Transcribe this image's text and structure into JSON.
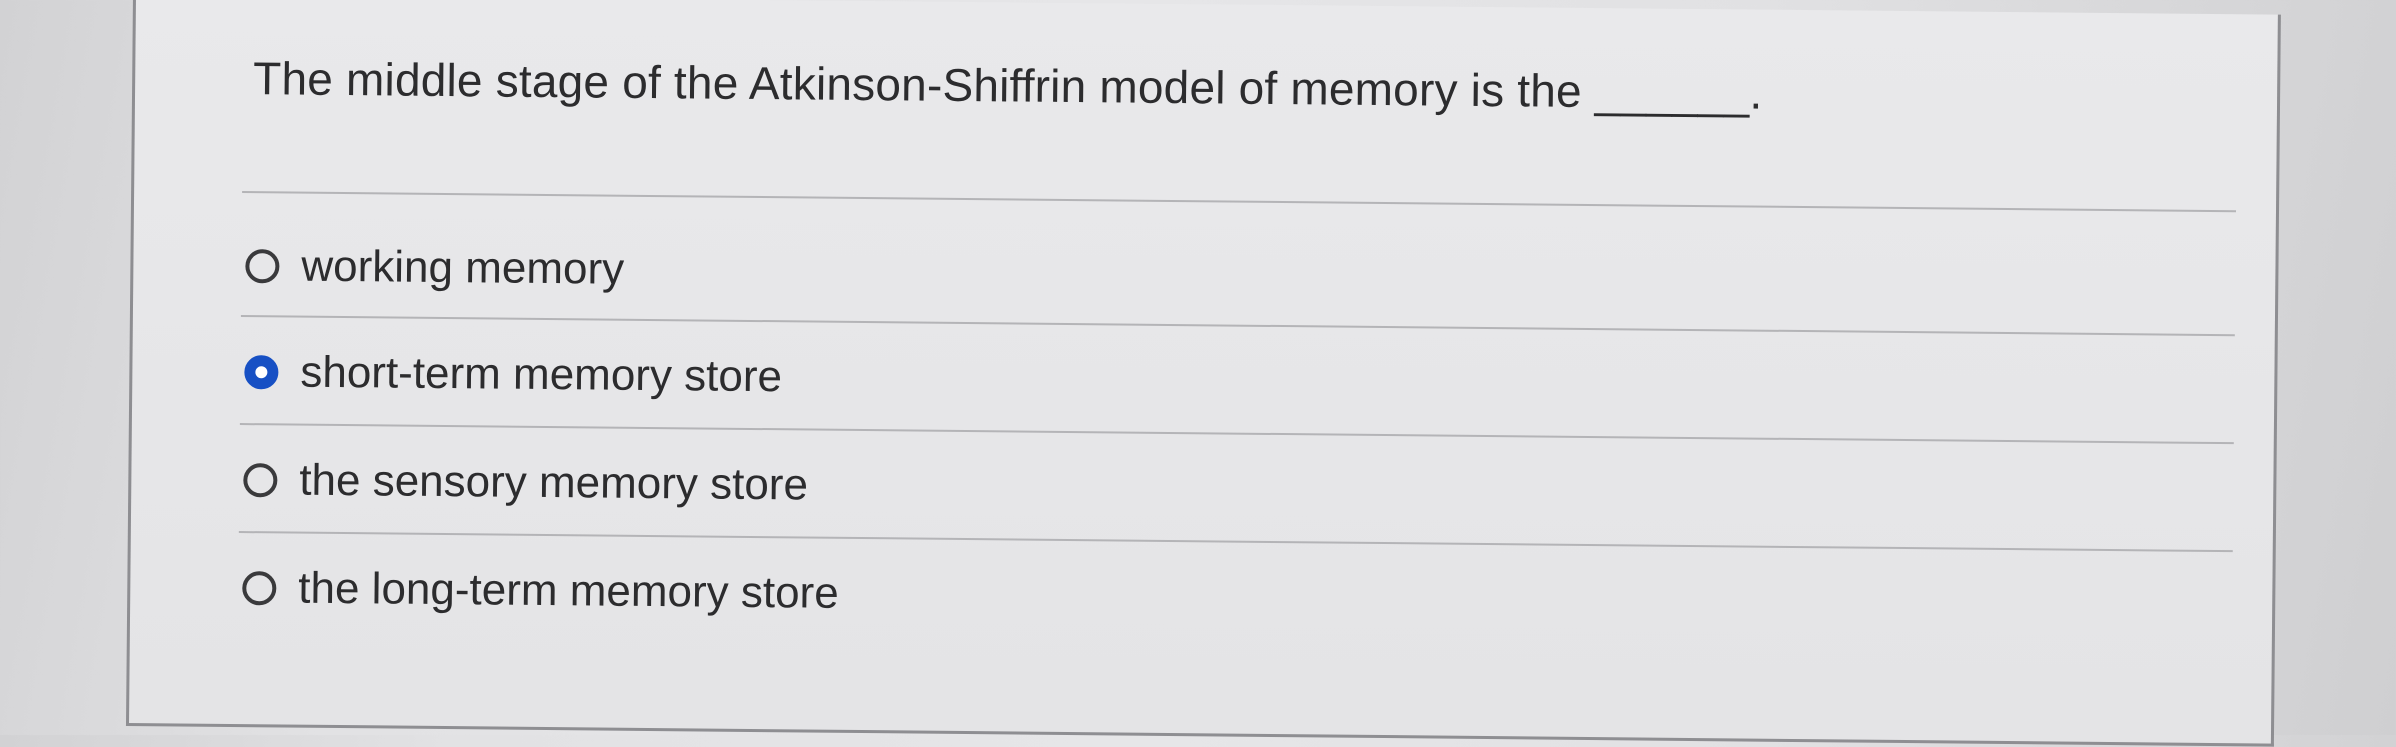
{
  "question": {
    "text": "The middle stage of the Atkinson-Shiffrin model of memory is the ______."
  },
  "options": [
    {
      "label": "working memory",
      "selected": false
    },
    {
      "label": "short-term memory store",
      "selected": true
    },
    {
      "label": "the sensory memory store",
      "selected": false
    },
    {
      "label": "the long-term memory store",
      "selected": false
    }
  ],
  "colors": {
    "selected_radio": "#1750c4",
    "text": "#2c2c2e",
    "divider": "#b4b4b7"
  }
}
